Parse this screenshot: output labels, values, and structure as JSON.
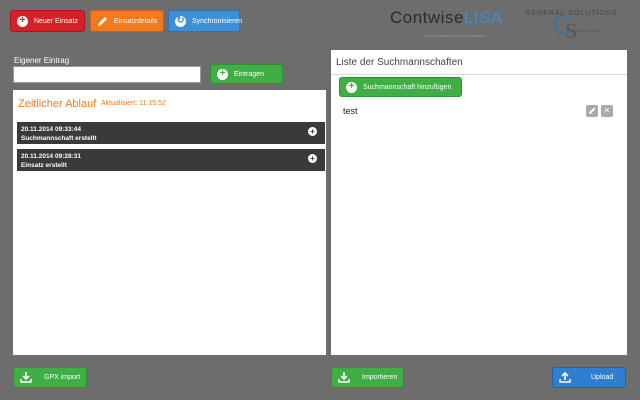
{
  "toolbar": {
    "new_mission_label": "Neuer Einsatz",
    "mission_details_label": "Einsatzdetails",
    "sync_label": "Synchronisieren"
  },
  "logo": {
    "brand_main": "Contwise",
    "brand_accent": "LISA",
    "brand_sub": "Live Interactive Search Application",
    "partner_name": "GENERAL SOLUTIONS",
    "partner_sub": "Steiner GmbH"
  },
  "own_entry": {
    "label": "Eigener Eintrag",
    "value": "",
    "submit_label": "Eintragen"
  },
  "timeline": {
    "title": "Zeitlicher Ablauf",
    "updated": "Aktualisiert: 11:15:52",
    "entries": [
      {
        "time": "20.11.2014 09:33:44",
        "text": "Suchmannschaft erstellt"
      },
      {
        "time": "20.11.2014 09:28:31",
        "text": "Einsatz erstellt"
      }
    ]
  },
  "teams": {
    "title": "Liste der Suchmannschaften",
    "add_label": "Suchmannschaft hinzufügen",
    "items": [
      {
        "name": "test"
      }
    ]
  },
  "footer": {
    "gpx_import_label": "GPX import",
    "import_label": "Importieren",
    "upload_label": "Upload"
  },
  "colors": {
    "danger": "#d6202a",
    "warning": "#f07a1c",
    "primary": "#3d8fd6",
    "success": "#3fae44",
    "background": "#6d6d6d"
  }
}
